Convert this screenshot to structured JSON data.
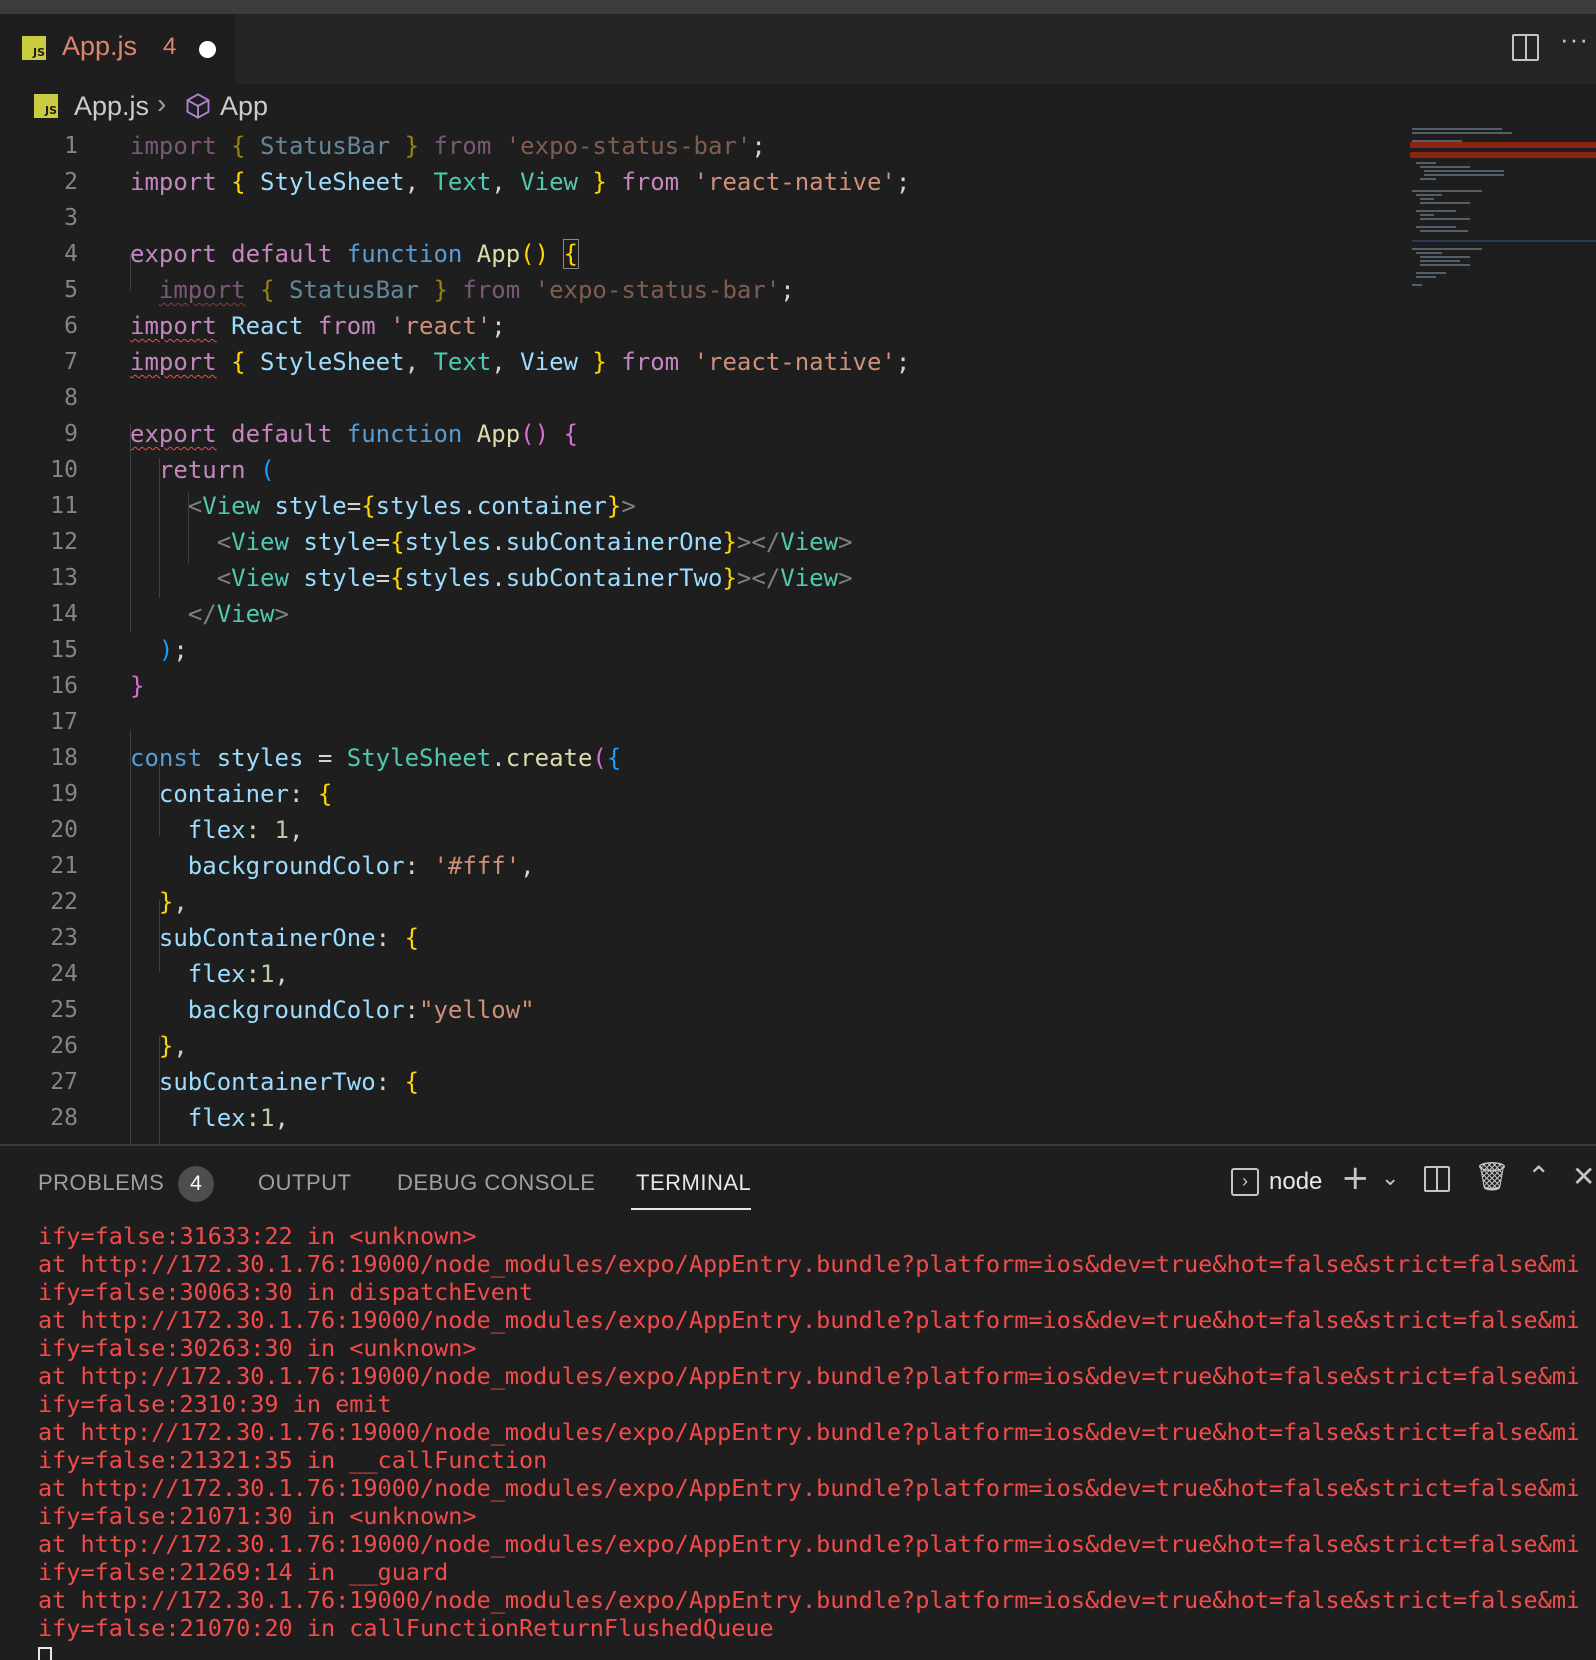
{
  "tab": {
    "filename": "App.js",
    "problems_count": "4",
    "icon_label": "JS"
  },
  "breadcrumb": {
    "file": "App.js",
    "separator": "›",
    "symbol": "App"
  },
  "colors": {
    "accent_error": "#f14c4c",
    "js_icon": "#cbcb41",
    "modified_tab_text": "#e2836f"
  },
  "editor": {
    "lines": [
      {
        "n": "1",
        "tokens": [
          [
            "import",
            "k",
            ""
          ],
          [
            " ",
            "p",
            ""
          ],
          [
            "{",
            "y",
            ""
          ],
          [
            " StatusBar ",
            "v",
            ""
          ],
          [
            "}",
            "y",
            ""
          ],
          [
            " from ",
            "k",
            ""
          ],
          [
            "'expo-status-bar'",
            "s",
            ""
          ],
          [
            ";",
            "p",
            ""
          ]
        ],
        "dim": true
      },
      {
        "n": "2",
        "tokens": [
          [
            "import",
            "k",
            ""
          ],
          [
            " ",
            "p",
            ""
          ],
          [
            "{",
            "y",
            ""
          ],
          [
            " StyleSheet",
            "v",
            ""
          ],
          [
            ", ",
            "p",
            ""
          ],
          [
            "Text",
            "c",
            ""
          ],
          [
            ", ",
            "p",
            ""
          ],
          [
            "View",
            "c",
            ""
          ],
          [
            " ",
            "p",
            ""
          ],
          [
            "}",
            "y",
            ""
          ],
          [
            " from ",
            "k",
            ""
          ],
          [
            "'react-native'",
            "s",
            ""
          ],
          [
            ";",
            "p",
            ""
          ]
        ]
      },
      {
        "n": "3",
        "tokens": []
      },
      {
        "n": "4",
        "tokens": [
          [
            "export",
            "k",
            ""
          ],
          [
            " default ",
            "k",
            ""
          ],
          [
            "function",
            "kb",
            ""
          ],
          [
            " ",
            "p",
            ""
          ],
          [
            "App",
            "f",
            ""
          ],
          [
            "()",
            "y",
            ""
          ],
          [
            " ",
            "p",
            ""
          ],
          [
            "{",
            "y",
            "bm"
          ]
        ]
      },
      {
        "n": "5",
        "tokens": [
          [
            "  ",
            "p",
            ""
          ],
          [
            "import",
            "k",
            "squig"
          ],
          [
            " ",
            "p",
            ""
          ],
          [
            "{",
            "y",
            ""
          ],
          [
            " StatusBar ",
            "v",
            ""
          ],
          [
            "}",
            "y",
            ""
          ],
          [
            " from ",
            "k",
            ""
          ],
          [
            "'expo-status-bar'",
            "s",
            ""
          ],
          [
            ";",
            "p",
            ""
          ]
        ],
        "dim": true
      },
      {
        "n": "6",
        "tokens": [
          [
            "import",
            "k",
            "squig"
          ],
          [
            " ",
            "p",
            ""
          ],
          [
            "React",
            "v",
            ""
          ],
          [
            " from ",
            "k",
            ""
          ],
          [
            "'react'",
            "s",
            ""
          ],
          [
            ";",
            "p",
            ""
          ]
        ]
      },
      {
        "n": "7",
        "tokens": [
          [
            "import",
            "k",
            "squig"
          ],
          [
            " ",
            "p",
            ""
          ],
          [
            "{",
            "y",
            ""
          ],
          [
            " StyleSheet",
            "v",
            ""
          ],
          [
            ", ",
            "p",
            ""
          ],
          [
            "Text",
            "c",
            ""
          ],
          [
            ", ",
            "p",
            ""
          ],
          [
            "View",
            "v",
            ""
          ],
          [
            " ",
            "p",
            ""
          ],
          [
            "}",
            "y",
            ""
          ],
          [
            " from ",
            "k",
            ""
          ],
          [
            "'react-native'",
            "s",
            ""
          ],
          [
            ";",
            "p",
            ""
          ]
        ]
      },
      {
        "n": "8",
        "tokens": []
      },
      {
        "n": "9",
        "tokens": [
          [
            "export",
            "k",
            "squig"
          ],
          [
            " default ",
            "k",
            ""
          ],
          [
            "function",
            "kb",
            ""
          ],
          [
            " ",
            "p",
            ""
          ],
          [
            "App",
            "f",
            ""
          ],
          [
            "()",
            "m",
            ""
          ],
          [
            " ",
            "p",
            ""
          ],
          [
            "{",
            "m",
            ""
          ]
        ]
      },
      {
        "n": "10",
        "tokens": [
          [
            "  ",
            "p",
            ""
          ],
          [
            "return",
            "k",
            ""
          ],
          [
            " ",
            "p",
            ""
          ],
          [
            "(",
            "b",
            ""
          ]
        ]
      },
      {
        "n": "11",
        "tokens": [
          [
            "    ",
            "p",
            ""
          ],
          [
            "<",
            "g",
            ""
          ],
          [
            "View",
            "c",
            ""
          ],
          [
            " style",
            "v",
            ""
          ],
          [
            "=",
            "p",
            ""
          ],
          [
            "{",
            "y",
            ""
          ],
          [
            "styles",
            "v",
            ""
          ],
          [
            ".",
            "p",
            ""
          ],
          [
            "container",
            "v",
            ""
          ],
          [
            "}",
            "y",
            ""
          ],
          [
            ">",
            "g",
            ""
          ]
        ]
      },
      {
        "n": "12",
        "tokens": [
          [
            "      ",
            "p",
            ""
          ],
          [
            "<",
            "g",
            ""
          ],
          [
            "View",
            "c",
            ""
          ],
          [
            " style",
            "v",
            ""
          ],
          [
            "=",
            "p",
            ""
          ],
          [
            "{",
            "y",
            ""
          ],
          [
            "styles",
            "v",
            ""
          ],
          [
            ".",
            "p",
            ""
          ],
          [
            "subContainerOne",
            "v",
            ""
          ],
          [
            "}",
            "y",
            ""
          ],
          [
            "></",
            "g",
            ""
          ],
          [
            "View",
            "c",
            ""
          ],
          [
            ">",
            "g",
            ""
          ]
        ]
      },
      {
        "n": "13",
        "tokens": [
          [
            "      ",
            "p",
            ""
          ],
          [
            "<",
            "g",
            ""
          ],
          [
            "View",
            "c",
            ""
          ],
          [
            " style",
            "v",
            ""
          ],
          [
            "=",
            "p",
            ""
          ],
          [
            "{",
            "y",
            ""
          ],
          [
            "styles",
            "v",
            ""
          ],
          [
            ".",
            "p",
            ""
          ],
          [
            "subContainerTwo",
            "v",
            ""
          ],
          [
            "}",
            "y",
            ""
          ],
          [
            "></",
            "g",
            ""
          ],
          [
            "View",
            "c",
            ""
          ],
          [
            ">",
            "g",
            ""
          ]
        ]
      },
      {
        "n": "14",
        "tokens": [
          [
            "    ",
            "p",
            ""
          ],
          [
            "</",
            "g",
            ""
          ],
          [
            "View",
            "c",
            ""
          ],
          [
            ">",
            "g",
            ""
          ]
        ]
      },
      {
        "n": "15",
        "tokens": [
          [
            "  ",
            "p",
            ""
          ],
          [
            ")",
            "b",
            ""
          ],
          [
            ";",
            "p",
            ""
          ]
        ]
      },
      {
        "n": "16",
        "tokens": [
          [
            "}",
            "m",
            ""
          ]
        ]
      },
      {
        "n": "17",
        "tokens": []
      },
      {
        "n": "18",
        "tokens": [
          [
            "const",
            "kb",
            ""
          ],
          [
            " ",
            "p",
            ""
          ],
          [
            "styles",
            "v",
            ""
          ],
          [
            " = ",
            "p",
            ""
          ],
          [
            "StyleSheet",
            "c",
            ""
          ],
          [
            ".",
            "p",
            ""
          ],
          [
            "create",
            "f",
            ""
          ],
          [
            "(",
            "m",
            ""
          ],
          [
            "{",
            "b",
            ""
          ]
        ]
      },
      {
        "n": "19",
        "tokens": [
          [
            "  ",
            "p",
            ""
          ],
          [
            "container",
            "v",
            ""
          ],
          [
            ": ",
            "p",
            ""
          ],
          [
            "{",
            "y",
            ""
          ]
        ]
      },
      {
        "n": "20",
        "tokens": [
          [
            "    ",
            "p",
            ""
          ],
          [
            "flex",
            "v",
            ""
          ],
          [
            ": ",
            "p",
            ""
          ],
          [
            "1",
            "n",
            ""
          ],
          [
            ",",
            "p",
            ""
          ]
        ]
      },
      {
        "n": "21",
        "tokens": [
          [
            "    ",
            "p",
            ""
          ],
          [
            "backgroundColor",
            "v",
            ""
          ],
          [
            ": ",
            "p",
            ""
          ],
          [
            "'#fff'",
            "s",
            ""
          ],
          [
            ",",
            "p",
            ""
          ]
        ]
      },
      {
        "n": "22",
        "tokens": [
          [
            "  ",
            "p",
            ""
          ],
          [
            "}",
            "y",
            ""
          ],
          [
            ",",
            "p",
            ""
          ]
        ]
      },
      {
        "n": "23",
        "tokens": [
          [
            "  ",
            "p",
            ""
          ],
          [
            "subContainerOne",
            "v",
            ""
          ],
          [
            ": ",
            "p",
            ""
          ],
          [
            "{",
            "y",
            ""
          ]
        ]
      },
      {
        "n": "24",
        "tokens": [
          [
            "    ",
            "p",
            ""
          ],
          [
            "flex",
            "v",
            ""
          ],
          [
            ":",
            "p",
            ""
          ],
          [
            "1",
            "n",
            ""
          ],
          [
            ",",
            "p",
            ""
          ]
        ]
      },
      {
        "n": "25",
        "tokens": [
          [
            "    ",
            "p",
            ""
          ],
          [
            "backgroundColor",
            "v",
            ""
          ],
          [
            ":",
            "p",
            ""
          ],
          [
            "\"yellow\"",
            "s",
            ""
          ]
        ]
      },
      {
        "n": "26",
        "tokens": [
          [
            "  ",
            "p",
            ""
          ],
          [
            "}",
            "y",
            ""
          ],
          [
            ",",
            "p",
            ""
          ]
        ]
      },
      {
        "n": "27",
        "tokens": [
          [
            "  ",
            "p",
            ""
          ],
          [
            "subContainerTwo",
            "v",
            ""
          ],
          [
            ": ",
            "p",
            ""
          ],
          [
            "{",
            "y",
            ""
          ]
        ]
      },
      {
        "n": "28",
        "tokens": [
          [
            "    ",
            "p",
            ""
          ],
          [
            "flex",
            "v",
            ""
          ],
          [
            ":",
            "p",
            ""
          ],
          [
            "1",
            "n",
            ""
          ],
          [
            ",",
            "p",
            ""
          ]
        ]
      }
    ]
  },
  "panel": {
    "tabs": [
      {
        "label": "PROBLEMS",
        "name": "tab-problems"
      },
      {
        "label": "OUTPUT",
        "name": "tab-output"
      },
      {
        "label": "DEBUG CONSOLE",
        "name": "tab-debug-console"
      },
      {
        "label": "TERMINAL",
        "name": "tab-terminal"
      }
    ],
    "problems_badge": "4",
    "terminal_name": "node",
    "icons": [
      "terminal-icon",
      "add-terminal-icon",
      "chevron-down-icon",
      "split-terminal-icon",
      "trash-icon",
      "maximize-panel-icon",
      "close-panel-icon"
    ]
  },
  "terminal": {
    "lines": [
      "ify=false:31633:22 in <unknown>",
      "at http://172.30.1.76:19000/node_modules/expo/AppEntry.bundle?platform=ios&dev=true&hot=false&strict=false&min",
      "ify=false:30063:30 in dispatchEvent",
      "at http://172.30.1.76:19000/node_modules/expo/AppEntry.bundle?platform=ios&dev=true&hot=false&strict=false&min",
      "ify=false:30263:30 in <unknown>",
      "at http://172.30.1.76:19000/node_modules/expo/AppEntry.bundle?platform=ios&dev=true&hot=false&strict=false&min",
      "ify=false:2310:39 in emit",
      "at http://172.30.1.76:19000/node_modules/expo/AppEntry.bundle?platform=ios&dev=true&hot=false&strict=false&min",
      "ify=false:21321:35 in __callFunction",
      "at http://172.30.1.76:19000/node_modules/expo/AppEntry.bundle?platform=ios&dev=true&hot=false&strict=false&min",
      "ify=false:21071:30 in <unknown>",
      "at http://172.30.1.76:19000/node_modules/expo/AppEntry.bundle?platform=ios&dev=true&hot=false&strict=false&min",
      "ify=false:21269:14 in __guard",
      "at http://172.30.1.76:19000/node_modules/expo/AppEntry.bundle?platform=ios&dev=true&hot=false&strict=false&min",
      "ify=false:21070:20 in callFunctionReturnFlushedQueue"
    ]
  }
}
